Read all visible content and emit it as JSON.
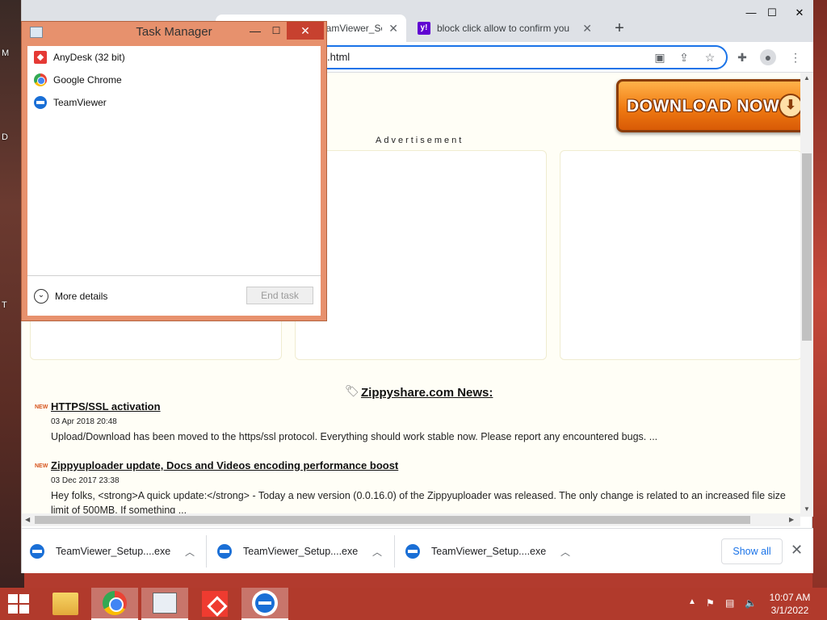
{
  "desktop": {
    "labels": [
      "M",
      "D",
      "T"
    ]
  },
  "browser": {
    "tabs": [
      {
        "title": "eamViewer_Se",
        "active": true
      },
      {
        "title": "block click allow to confirm you",
        "active": false
      }
    ],
    "new_tab": "+",
    "address": ".html",
    "window_controls": {
      "minimize": "—",
      "maximize": "☐",
      "close": "✕"
    }
  },
  "page": {
    "download_button": "DOWNLOAD NOW",
    "advertisement": "Advertisement",
    "news_heading": "Zippyshare.com News:",
    "news": [
      {
        "badge": "NEW",
        "title": "HTTPS/SSL activation",
        "date": "03 Apr 2018 20:48",
        "body": "Upload/Download has been moved to the https/ssl protocol. Everything should work stable now. Please report any encountered bugs. ..."
      },
      {
        "badge": "NEW",
        "title": "Zippyuploader update, Docs and Videos encoding performance boost",
        "date": "03 Dec 2017 23:38",
        "body": "Hey folks, <strong>A quick update:</strong> - Today a new version (0.0.16.0) of the Zippyuploader was released. The only change is related to an increased file size limit of 500MB. If something ..."
      }
    ]
  },
  "downloads": {
    "items": [
      {
        "name": "TeamViewer_Setup....exe"
      },
      {
        "name": "TeamViewer_Setup....exe"
      },
      {
        "name": "TeamViewer_Setup....exe"
      }
    ],
    "show_all": "Show all"
  },
  "task_manager": {
    "title": "Task Manager",
    "apps": [
      {
        "name": "AnyDesk (32 bit)",
        "icon": "anydesk-icon"
      },
      {
        "name": "Google Chrome",
        "icon": "chrome-icon"
      },
      {
        "name": "TeamViewer",
        "icon": "teamviewer-icon"
      }
    ],
    "more_details": "More details",
    "end_task": "End task"
  },
  "taskbar": {
    "apps": [
      "file-explorer-icon",
      "chrome-icon",
      "task-manager-icon",
      "anydesk-icon",
      "teamviewer-icon"
    ],
    "clock_time": "10:07 AM",
    "clock_date": "3/1/2022"
  },
  "colors": {
    "taskbar": "#b13a2c",
    "task_manager_frame": "#e7916d",
    "accent_blue": "#1a73e8",
    "download_orange": "#f07b12"
  }
}
